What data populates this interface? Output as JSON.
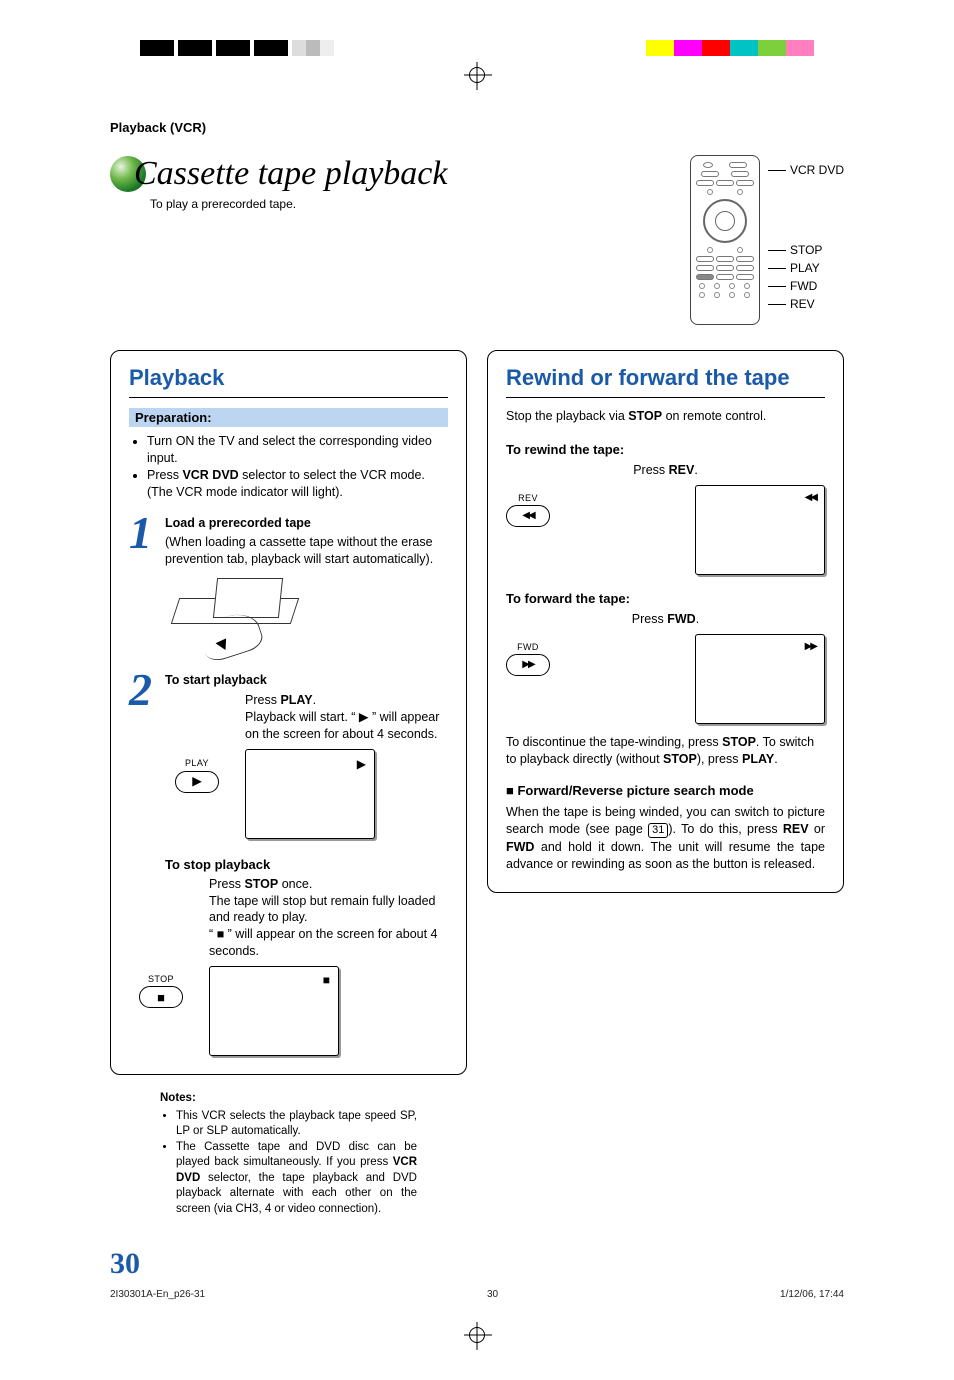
{
  "header": "Playback (VCR)",
  "title": "Cassette tape playback",
  "subtitle": "To play a prerecorded tape.",
  "remote_labels": {
    "top": "VCR DVD",
    "l1": "STOP",
    "l2": "PLAY",
    "l3": "FWD",
    "l4": "REV"
  },
  "left": {
    "title": "Playback",
    "prep_label": "Preparation:",
    "prep_items": [
      "Turn ON the TV and select the corresponding video input.",
      "Press VCR DVD selector to select the VCR mode. (The VCR mode indicator will light)."
    ],
    "step1": {
      "num": "1",
      "head": "Load a prerecorded tape",
      "body": "(When loading a cassette tape without the erase prevention tab, playback will start automatically)."
    },
    "step2": {
      "num": "2",
      "head": "To start playback",
      "line1_pre": "Press ",
      "line1_bold": "PLAY",
      "line1_post": ".",
      "line2": "Playback will start. “ ▶ ” will appear on the screen for about 4 seconds.",
      "btn_label": "PLAY",
      "screen_icon": "▶"
    },
    "step3": {
      "head": "To stop playback",
      "line1_pre": "Press ",
      "line1_bold": "STOP",
      "line1_post": " once.",
      "line2": "The tape will stop but remain fully loaded and ready to play.",
      "line3": "“ ■ ” will appear on the screen for about 4 seconds.",
      "btn_label": "STOP",
      "screen_icon": "■"
    }
  },
  "right": {
    "title": "Rewind or forward the tape",
    "intro_pre": "Stop the playback via ",
    "intro_bold": "STOP",
    "intro_post": " on remote control.",
    "rewind": {
      "head": "To rewind the tape:",
      "press_pre": "Press ",
      "press_bold": "REV",
      "press_post": ".",
      "btn_label": "REV",
      "btn_glyph": "◀◀",
      "screen_icon": "◀◀"
    },
    "forward": {
      "head": "To forward the tape:",
      "press_pre": "Press ",
      "press_bold": "FWD",
      "press_post": ".",
      "btn_label": "FWD",
      "btn_glyph": "▶▶",
      "screen_icon": "▶▶"
    },
    "discontinue": "To discontinue the tape-winding, press STOP. To switch to playback directly (without STOP), press PLAY.",
    "search_head": "Forward/Reverse picture search mode",
    "search_body_pre": "When the tape is being winded, you can switch to picture search mode (see page ",
    "search_page": "31",
    "search_body_post": "). To do this, press REV or FWD and hold it down. The unit will resume the tape advance or rewinding as soon as the button is released."
  },
  "notes": {
    "title": "Notes:",
    "items": [
      "This VCR selects the playback tape speed SP, LP or SLP automatically.",
      "The Cassette tape and DVD disc can be played back simultaneously. If you press VCR DVD selector, the tape playback and DVD playback alternate with each other on the screen (via CH3, 4 or video connection)."
    ]
  },
  "page_number": "30",
  "footer": {
    "left": "2I30301A-En_p26-31",
    "center": "30",
    "right": "1/12/06, 17:44"
  },
  "colors": {
    "bar_right": [
      "#ffff00",
      "#ff00ff",
      "#ff0000",
      "#00c4c4",
      "#7dd03c",
      "#ff7fbf"
    ]
  }
}
